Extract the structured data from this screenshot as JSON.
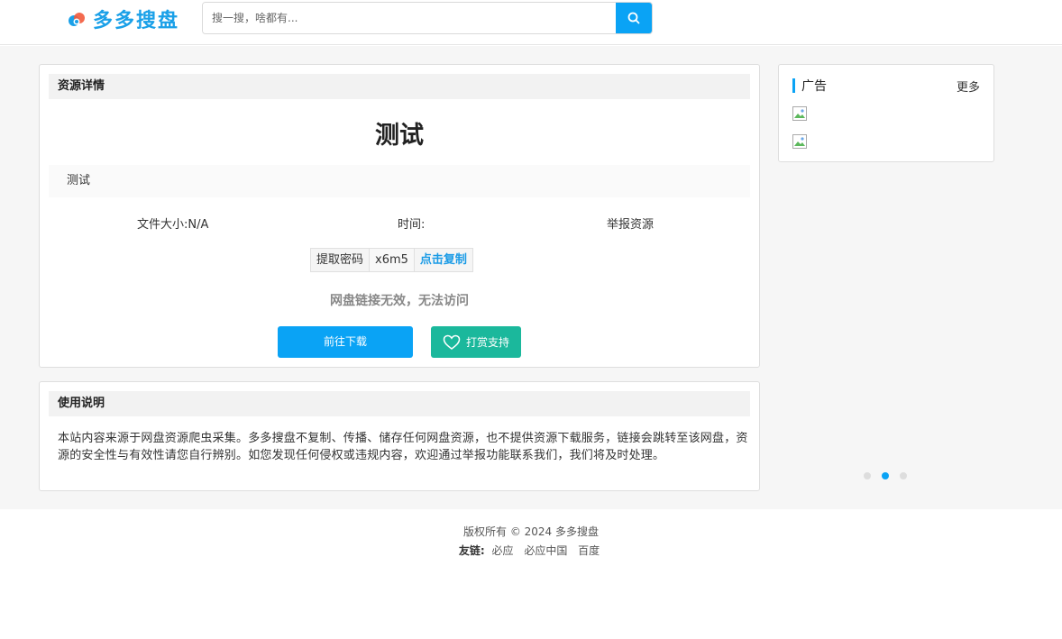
{
  "header": {
    "logo_text": "多多搜盘",
    "search_placeholder": "搜一搜，啥都有...",
    "search_value": ""
  },
  "detail": {
    "section_title": "资源详情",
    "title": "测试",
    "description": "测试",
    "file_size": "文件大小:N/A",
    "time": "时间:",
    "report": "举报资源",
    "code_label": "提取密码",
    "code_value": "x6m5",
    "copy_label": "点击复制",
    "invalid_msg": "网盘链接无效，无法访问",
    "download_label": "前往下载",
    "tip_label": "打赏支持"
  },
  "notice": {
    "section_title": "使用说明",
    "text": "本站内容来源于网盘资源爬虫采集。多多搜盘不复制、传播、储存任何网盘资源，也不提供资源下载服务，链接会跳转至该网盘，资源的安全性与有效性请您自行辨别。如您发现任何侵权或违规内容，欢迎通过举报功能联系我们，我们将及时处理。"
  },
  "sidebar": {
    "ad_title": "广告",
    "more_label": "更多",
    "carousel_active_index": 1,
    "carousel_count": 3
  },
  "footer": {
    "copyright": "版权所有 © 2024 多多搜盘",
    "links_label": "友链:",
    "links": [
      "必应",
      "必应中国",
      "百度"
    ]
  },
  "colors": {
    "accent": "#0aa3f5",
    "tip_button": "#1bb89c",
    "brand": "#1aa0e8"
  }
}
